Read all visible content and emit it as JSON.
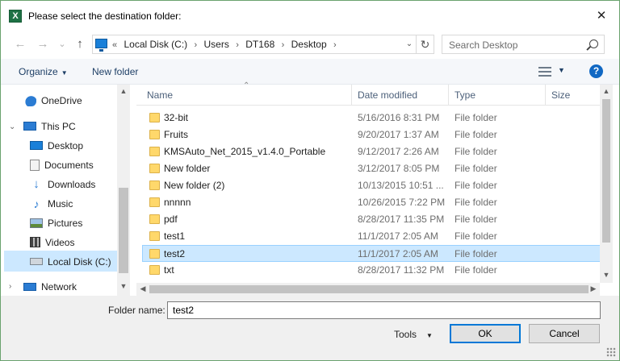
{
  "titlebar": {
    "title": "Please select the destination folder:",
    "app_icon": "X",
    "close_glyph": "✕"
  },
  "nav": {
    "back_glyph": "←",
    "forward_glyph": "→",
    "recent_glyph": "⌄",
    "up_glyph": "↑"
  },
  "address": {
    "overflow": "«",
    "crumbs": [
      "Local Disk (C:)",
      "Users",
      "DT168",
      "Desktop"
    ],
    "separator": "›",
    "dropdown_glyph": "⌄",
    "refresh_glyph": "↻"
  },
  "search": {
    "placeholder": "Search Desktop"
  },
  "toolbar": {
    "organize": "Organize",
    "new_folder": "New folder",
    "help": "?"
  },
  "sidebar": {
    "items": [
      {
        "label": "OneDrive",
        "icon": "cloud-icon"
      },
      {
        "label": "This PC",
        "icon": "computer-icon"
      },
      {
        "label": "Desktop",
        "icon": "desktop-icon"
      },
      {
        "label": "Documents",
        "icon": "documents-icon"
      },
      {
        "label": "Downloads",
        "icon": "download-icon"
      },
      {
        "label": "Music",
        "icon": "music-icon"
      },
      {
        "label": "Pictures",
        "icon": "pictures-icon"
      },
      {
        "label": "Videos",
        "icon": "videos-icon"
      },
      {
        "label": "Local Disk (C:)",
        "icon": "disk-icon",
        "selected": true
      },
      {
        "label": "Network",
        "icon": "network-icon"
      }
    ]
  },
  "files": {
    "columns": [
      "Name",
      "Date modified",
      "Type",
      "Size"
    ],
    "rows": [
      {
        "name": "32-bit",
        "date": "5/16/2016 8:31 PM",
        "type": "File folder"
      },
      {
        "name": "Fruits",
        "date": "9/20/2017 1:37 AM",
        "type": "File folder"
      },
      {
        "name": "KMSAuto_Net_2015_v1.4.0_Portable",
        "date": "9/12/2017 2:26 AM",
        "type": "File folder"
      },
      {
        "name": "New folder",
        "date": "3/12/2017 8:05 PM",
        "type": "File folder"
      },
      {
        "name": "New folder (2)",
        "date": "10/13/2015 10:51 ...",
        "type": "File folder"
      },
      {
        "name": "nnnnn",
        "date": "10/26/2015 7:22 PM",
        "type": "File folder"
      },
      {
        "name": "pdf",
        "date": "8/28/2017 11:35 PM",
        "type": "File folder"
      },
      {
        "name": "test1",
        "date": "11/1/2017 2:05 AM",
        "type": "File folder"
      },
      {
        "name": "test2",
        "date": "11/1/2017 2:05 AM",
        "type": "File folder",
        "selected": true
      },
      {
        "name": "txt",
        "date": "8/28/2017 11:32 PM",
        "type": "File folder"
      }
    ]
  },
  "footer": {
    "folder_name_label": "Folder name:",
    "folder_name_value": "test2",
    "tools": "Tools",
    "ok": "OK",
    "cancel": "Cancel"
  },
  "colors": {
    "selection": "#cce8ff",
    "selection_border": "#99d1ff",
    "accent": "#0078d7",
    "folder": "#ffd86b"
  }
}
